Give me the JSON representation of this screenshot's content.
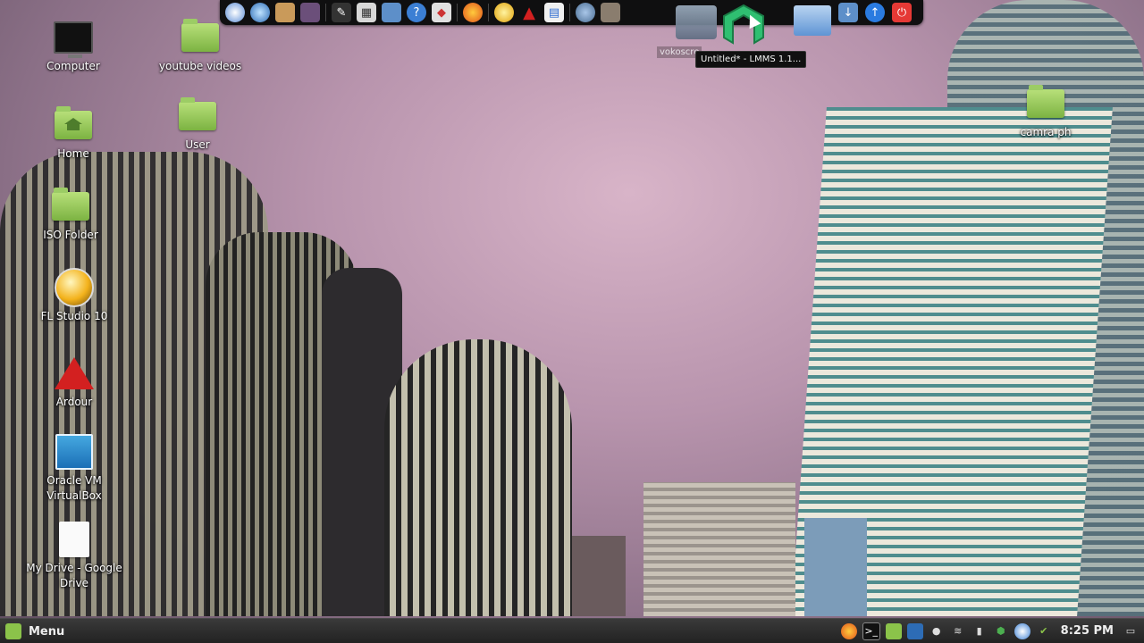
{
  "dock": {
    "icons": [
      "chromium-icon",
      "thunderbird-icon",
      "package-icon",
      "workspace-switcher-icon",
      "gimp-icon",
      "calculator-icon",
      "home-folder-icon",
      "help-icon",
      "software-manager-icon",
      "firefox-icon",
      "fl-studio-icon",
      "ardour-icon",
      "document-icon",
      "system-settings-icon",
      "media-icon",
      "vokoscreen-icon",
      "lmms-icon",
      "files-icon",
      "download-folder-icon",
      "update-icon",
      "power-icon"
    ],
    "ghost_label": "vokoscre",
    "tooltip": "Untitled* - LMMS 1.1...",
    "colors": {
      "background": "#0f0f10",
      "lmms": "#2fbf71"
    }
  },
  "desktop": {
    "icons": [
      {
        "name": "computer",
        "label": "Computer"
      },
      {
        "name": "youtube-videos",
        "label": "youtube videos"
      },
      {
        "name": "home",
        "label": "Home"
      },
      {
        "name": "user",
        "label": "User"
      },
      {
        "name": "iso-folder",
        "label": "ISO Folder"
      },
      {
        "name": "fl-studio",
        "label": "FL Studio 10"
      },
      {
        "name": "ardour",
        "label": "Ardour"
      },
      {
        "name": "virtualbox",
        "label": "Oracle VM VirtualBox"
      },
      {
        "name": "google-drive",
        "label": "My Drive - Google Drive"
      },
      {
        "name": "camra-ph",
        "label": "camra ph"
      }
    ]
  },
  "panel": {
    "menu_label": "Menu",
    "tray_icons": [
      "firefox-icon",
      "terminal-icon",
      "folder-icon",
      "virtualbox-icon",
      "user-icon",
      "wifi-icon",
      "battery-icon",
      "shield-icon",
      "chromium-icon",
      "update-check-icon"
    ],
    "clock": "8:25 PM",
    "colors": {
      "accent": "#8bc34a"
    }
  }
}
